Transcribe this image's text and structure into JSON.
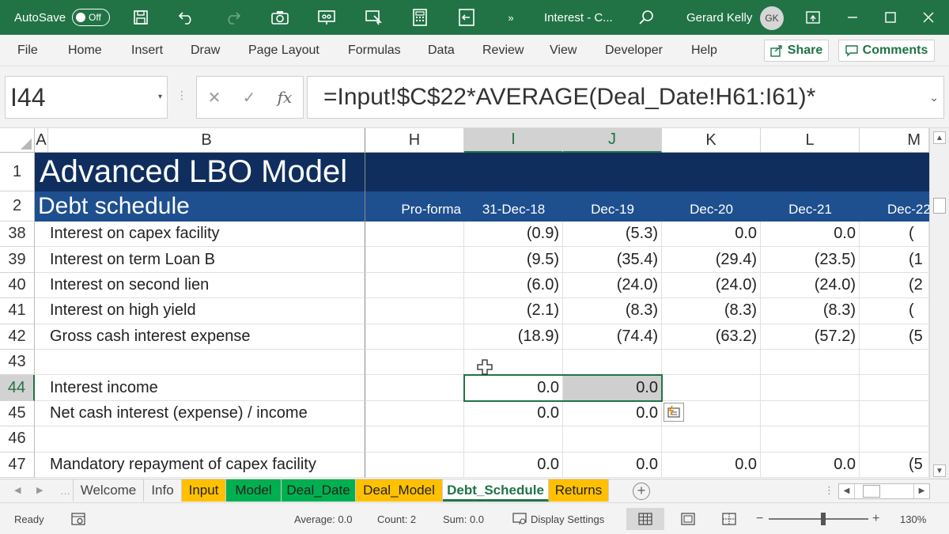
{
  "titlebar": {
    "autosave_label": "AutoSave",
    "autosave_state": "Off",
    "doc_title": "Interest - C...",
    "user_name": "Gerard Kelly",
    "user_initials": "GK",
    "accent_color": "#217346"
  },
  "ribbon": {
    "tabs": [
      "File",
      "Home",
      "Insert",
      "Draw",
      "Page Layout",
      "Formulas",
      "Data",
      "Review",
      "View",
      "Developer",
      "Help"
    ],
    "share_label": "Share",
    "comments_label": "Comments"
  },
  "formula_bar": {
    "name_box": "I44",
    "fx": "fx",
    "formula": "=Input!$C$22*AVERAGE(Deal_Date!H61:I61)*"
  },
  "grid": {
    "columns": [
      "A",
      "B",
      "H",
      "I",
      "J",
      "K",
      "L",
      "M"
    ],
    "selected_columns": [
      "I",
      "J"
    ],
    "banner": {
      "title": "Advanced LBO Model",
      "subtitle": "Debt schedule",
      "period_headers": [
        "Pro-forma",
        "31-Dec-18",
        "Dec-19",
        "Dec-20",
        "Dec-21",
        "Dec-22"
      ]
    },
    "rows": [
      {
        "num": "38",
        "label": "Interest on capex facility",
        "I": "(0.9)",
        "J": "(5.3)",
        "K": "0.0",
        "L": "0.0",
        "M": "("
      },
      {
        "num": "39",
        "label": "Interest on term Loan B",
        "I": "(9.5)",
        "J": "(35.4)",
        "K": "(29.4)",
        "L": "(23.5)",
        "M": "(1"
      },
      {
        "num": "40",
        "label": "Interest on second lien",
        "I": "(6.0)",
        "J": "(24.0)",
        "K": "(24.0)",
        "L": "(24.0)",
        "M": "(2"
      },
      {
        "num": "41",
        "label": "Interest on high yield",
        "I": "(2.1)",
        "J": "(8.3)",
        "K": "(8.3)",
        "L": "(8.3)",
        "M": "("
      },
      {
        "num": "42",
        "label": "Gross cash interest expense",
        "I": "(18.9)",
        "J": "(74.4)",
        "K": "(63.2)",
        "L": "(57.2)",
        "M": "(5"
      },
      {
        "num": "43",
        "label": "",
        "I": "",
        "J": "",
        "K": "",
        "L": "",
        "M": ""
      },
      {
        "num": "44",
        "label": "Interest income",
        "I": "0.0",
        "J": "0.0",
        "K": "",
        "L": "",
        "M": ""
      },
      {
        "num": "45",
        "label": "Net cash interest (expense) / income",
        "I": "0.0",
        "J": "0.0",
        "K": "",
        "L": "",
        "M": ""
      },
      {
        "num": "46",
        "label": "",
        "I": "",
        "J": "",
        "K": "",
        "L": "",
        "M": ""
      },
      {
        "num": "47",
        "label": "Mandatory repayment of capex facility",
        "I": "0.0",
        "J": "0.0",
        "K": "0.0",
        "L": "0.0",
        "M": "(5"
      }
    ],
    "banner_dark": "#0f2e5e",
    "banner_blue": "#1e4f8f"
  },
  "sheet_tabs": [
    {
      "name": "Welcome",
      "style": "plain"
    },
    {
      "name": "Info",
      "style": "plain"
    },
    {
      "name": "Input",
      "style": "orange"
    },
    {
      "name": "Model",
      "style": "green"
    },
    {
      "name": "Deal_Date",
      "style": "green"
    },
    {
      "name": "Deal_Model",
      "style": "orange"
    },
    {
      "name": "Debt_Schedule",
      "style": "active"
    },
    {
      "name": "Returns",
      "style": "orange"
    }
  ],
  "statusbar": {
    "mode": "Ready",
    "average": "Average: 0.0",
    "count": "Count: 2",
    "sum": "Sum: 0.0",
    "display_settings": "Display Settings",
    "zoom": "130%",
    "zoom_fraction": 0.55
  }
}
